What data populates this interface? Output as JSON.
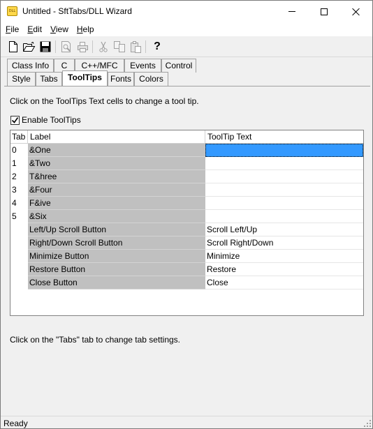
{
  "window": {
    "title": "Untitled - SftTabs/DLL Wizard",
    "app_icon_text": "DLL"
  },
  "menubar": {
    "items": [
      {
        "mnemonic": "F",
        "rest": "ile"
      },
      {
        "mnemonic": "E",
        "rest": "dit"
      },
      {
        "mnemonic": "V",
        "rest": "iew"
      },
      {
        "mnemonic": "H",
        "rest": "elp"
      }
    ]
  },
  "toolbar": {
    "icons": [
      "new-file-icon",
      "open-folder-icon",
      "save-disk-icon",
      "print-preview-icon",
      "print-icon",
      "cut-icon",
      "copy-icon",
      "paste-icon",
      "help-question-icon"
    ],
    "help_glyph": "?"
  },
  "tabs": {
    "row1": [
      "Class Info",
      "C",
      "C++/MFC",
      "Events",
      "Control"
    ],
    "row2": [
      "Style",
      "Tabs",
      "ToolTips",
      "Fonts",
      "Colors"
    ],
    "active": "ToolTips"
  },
  "page": {
    "instruction": "Click on the ToolTips Text cells to change a tool tip.",
    "enable_tooltips_label": "Enable ToolTips",
    "enable_tooltips_checked": true,
    "footer": "Click on the \"Tabs\" tab to change tab settings."
  },
  "grid": {
    "headers": {
      "tab": "Tab",
      "label": "Label",
      "tooltip": "ToolTip Text"
    },
    "rows": [
      {
        "tab": "0",
        "label": "&One",
        "tooltip": ""
      },
      {
        "tab": "1",
        "label": "&Two",
        "tooltip": ""
      },
      {
        "tab": "2",
        "label": "T&hree",
        "tooltip": ""
      },
      {
        "tab": "3",
        "label": "&Four",
        "tooltip": ""
      },
      {
        "tab": "4",
        "label": "F&ive",
        "tooltip": ""
      },
      {
        "tab": "5",
        "label": "&Six",
        "tooltip": ""
      },
      {
        "tab": "",
        "label": "Left/Up Scroll Button",
        "tooltip": "Scroll Left/Up"
      },
      {
        "tab": "",
        "label": "Right/Down Scroll Button",
        "tooltip": "Scroll Right/Down"
      },
      {
        "tab": "",
        "label": "Minimize Button",
        "tooltip": "Minimize"
      },
      {
        "tab": "",
        "label": "Restore Button",
        "tooltip": "Restore"
      },
      {
        "tab": "",
        "label": "Close Button",
        "tooltip": "Close"
      }
    ],
    "selected_row": 0
  },
  "statusbar": {
    "text": "Ready"
  }
}
